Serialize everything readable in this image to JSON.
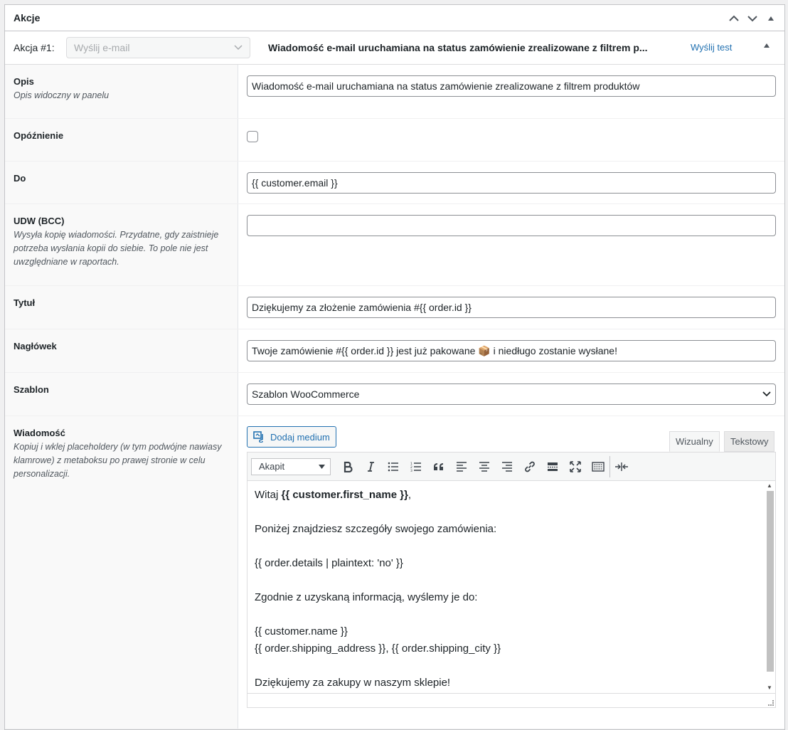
{
  "panel": {
    "title": "Akcje"
  },
  "action": {
    "label": "Akcja #1:",
    "select_value": "Wyślij e-mail",
    "description": "Wiadomość e-mail uruchamiana na status zamówienie zrealizowane z filtrem p...",
    "send_test": "Wyślij test"
  },
  "fields": {
    "opis": {
      "label": "Opis",
      "desc": "Opis widoczny w panelu",
      "value": "Wiadomość e-mail uruchamiana na status zamówienie zrealizowane z filtrem produktów"
    },
    "opoznienie": {
      "label": "Opóźnienie"
    },
    "do": {
      "label": "Do",
      "value": "{{ customer.email }}"
    },
    "udw": {
      "label": "UDW (BCC)",
      "desc": "Wysyła kopię wiadomości. Przydatne, gdy zaistnieje potrzeba wysłania kopii do siebie. To pole nie jest uwzględniane w raportach.",
      "value": ""
    },
    "tytul": {
      "label": "Tytuł",
      "value": "Dziękujemy za złożenie zamówienia #{{ order.id }}"
    },
    "naglowek": {
      "label": "Nagłówek",
      "value": "Twoje zamówienie #{{ order.id }} jest już pakowane 📦 i niedługo zostanie wysłane!"
    },
    "szablon": {
      "label": "Szablon",
      "value": "Szablon WooCommerce"
    },
    "wiadomosc": {
      "label": "Wiadomość",
      "desc": "Kopiuj i wklej placeholdery (w tym podwójne nawiasy klamrowe) z metaboksu po prawej stronie w celu personalizacji."
    }
  },
  "editor": {
    "media_button": "Dodaj medium",
    "tab_visual": "Wizualny",
    "tab_text": "Tekstowy",
    "format": "Akapit",
    "lines": {
      "greet_pre": "Witaj ",
      "greet_bold": "{{ customer.first_name }}",
      "greet_post": ",",
      "l2": "Poniżej znajdziesz szczegóły swojego zamówienia:",
      "l3": "{{ order.details | plaintext: 'no' }}",
      "l4": "Zgodnie z uzyskaną informacją, wyślemy je do:",
      "l5": "{{ customer.name }}",
      "l6": "{{ order.shipping_address }}, {{ order.shipping_city }}",
      "l7": "Dziękujemy za zakupy w naszym sklepie!"
    }
  },
  "colors": {
    "link": "#2271b1",
    "border": "#c3c4c7"
  }
}
